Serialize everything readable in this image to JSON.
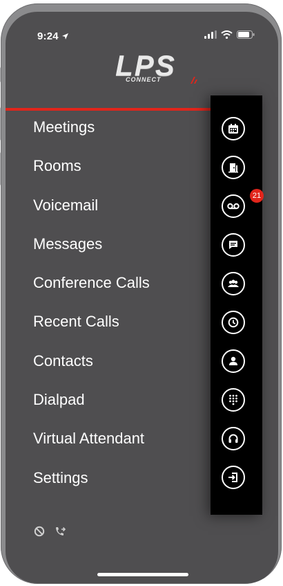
{
  "status_bar": {
    "time": "9:24"
  },
  "brand": {
    "logo_text": "LPS",
    "logo_subtext": "CONNECT"
  },
  "menu": {
    "items": [
      {
        "label": "Meetings"
      },
      {
        "label": "Rooms"
      },
      {
        "label": "Voicemail"
      },
      {
        "label": "Messages"
      },
      {
        "label": "Conference Calls"
      },
      {
        "label": "Recent Calls"
      },
      {
        "label": "Contacts"
      },
      {
        "label": "Dialpad"
      },
      {
        "label": "Virtual Attendant"
      },
      {
        "label": "Settings"
      }
    ]
  },
  "rail": {
    "icons": [
      "calendar-icon",
      "door-icon",
      "voicemail-icon",
      "message-icon",
      "conference-icon",
      "clock-icon",
      "contact-icon",
      "dialpad-icon",
      "headset-icon",
      "logout-icon"
    ],
    "voicemail_badge": "21"
  },
  "footer": {
    "icons": [
      "do-not-disturb-icon",
      "call-forward-icon"
    ]
  },
  "colors": {
    "accent": "#e1251b",
    "background": "#4f4e50",
    "rail": "#000000"
  }
}
